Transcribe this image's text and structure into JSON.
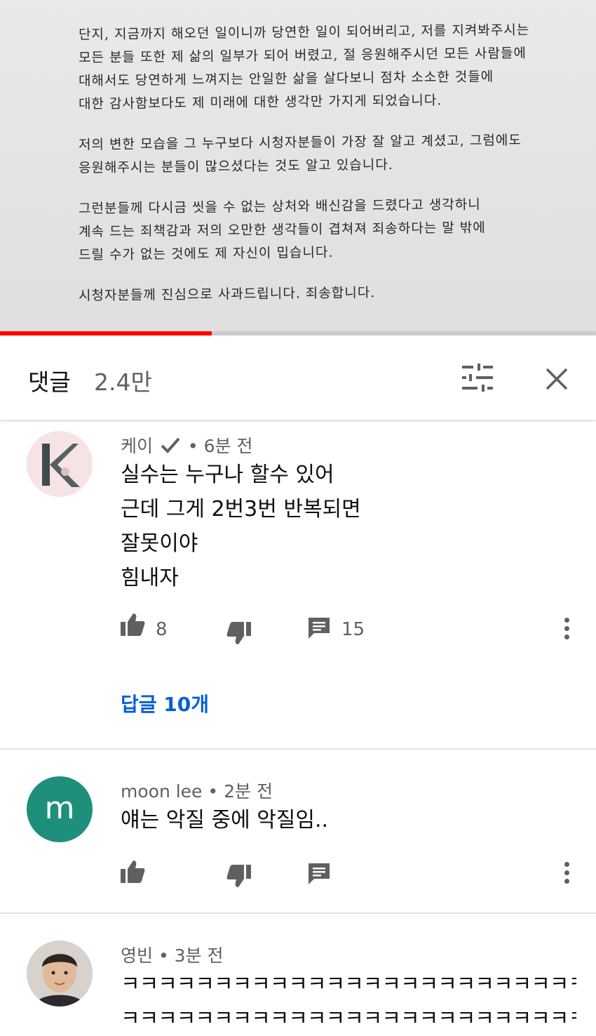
{
  "video": {
    "letter_paragraphs": [
      [
        "단지, 지금까지 해오던 일이니까 당연한 일이 되어버리고, 저를 지켜봐주시는",
        "모든 분들 또한 제 삶의 일부가 되어 버렸고, 절 응원해주시던 모든 사람들에",
        "대해서도 당연하게 느껴지는 안일한 삶을 살다보니 점차 소소한 것들에",
        "대한 감사함보다도 제 미래에 대한 생각만 가지게 되었습니다."
      ],
      [
        "저의 변한 모습을 그 누구보다 시청자분들이 가장 잘 알고 계셨고, 그럼에도",
        "응원해주시는 분들이 많으셨다는 것도 알고 있습니다."
      ],
      [
        "그런분들께 다시금 씻을 수 없는 상처와 배신감을 드렸다고 생각하니",
        "계속 드는 죄책감과 저의 오만한 생각들이 겹쳐져 죄송하다는 말 밖에",
        "드릴 수가 없는 것에도 제 자신이 밉습니다."
      ],
      [
        "시청자분들께 진심으로 사과드립니다. 죄송합니다."
      ]
    ],
    "progress_fraction": 0.355,
    "accent_color": "#ff0000"
  },
  "header": {
    "title": "댓글",
    "count": "2.4만",
    "sort_icon": "sort-icon",
    "close_icon": "close-icon"
  },
  "comments": [
    {
      "author": "케이",
      "verified": true,
      "time": "6분 전",
      "lines": [
        "실수는 누구나 할수 있어",
        "근데 그게 2번3번 반복되면",
        "잘못이야",
        "힘내자"
      ],
      "likes": "8",
      "reply_count": "15",
      "replies_link": "답글 10개",
      "avatar_letter": "K"
    },
    {
      "author": "moon lee",
      "time": "2분 전",
      "lines": [
        "얘는 악질 중에 악질임.."
      ],
      "likes": "",
      "reply_count": "",
      "avatar_letter": "m"
    },
    {
      "author": "영빈",
      "time": "3분 전",
      "lines": [
        "ㅋㅋㅋㅋㅋㅋㅋㅋㅋㅋㅋㅋㅋㅋㅋㅋㅋㅋㅋㅋㅋㅋㅋㅋㅋ",
        "ㅋㅋㅋㅋㅋㅋㅋㅋㅋㅋㅋㅋㅋㅋㅋㅋㅋㅋㅋㅋㅋㅋㅋㅋㅋ"
      ]
    }
  ],
  "colors": {
    "meta_text": "#606060",
    "link_blue": "#065fd4",
    "avatar_teal": "#1e8f7a"
  }
}
